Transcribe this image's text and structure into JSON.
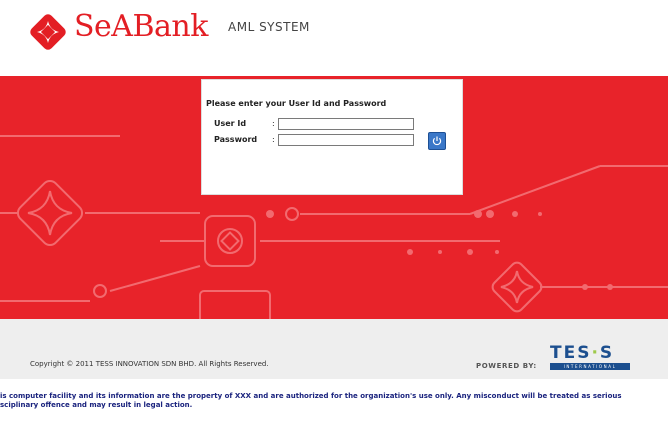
{
  "header": {
    "brand_name": "SeABank",
    "system_name": "AML SYSTEM"
  },
  "login": {
    "prompt": "Please enter your User Id and Password",
    "user_id_label": "User Id",
    "password_label": "Password",
    "colon": ":",
    "user_id_value": "",
    "password_value": "",
    "login_icon": "power-icon"
  },
  "footer": {
    "copyright": "Copyright © 2011 TESS INNOVATION SDN BHD. All Rights Reserved.",
    "powered_by": "POWERED BY:",
    "tess_word_1": "TES",
    "tess_dot": "·",
    "tess_word_2": "S",
    "tess_sub": "INTERNATIONAL",
    "disclaimer_line_1": "is computer facility and its information are the property of XXX and are authorized for the organization's use only. Any misconduct will be treated as serious",
    "disclaimer_line_2": "sciplinary offence and may result in legal action."
  },
  "colors": {
    "brand_red": "#e8232a",
    "tess_blue": "#1c4f8f",
    "tess_green": "#9ec94a",
    "disclaimer_navy": "#1a237e"
  }
}
